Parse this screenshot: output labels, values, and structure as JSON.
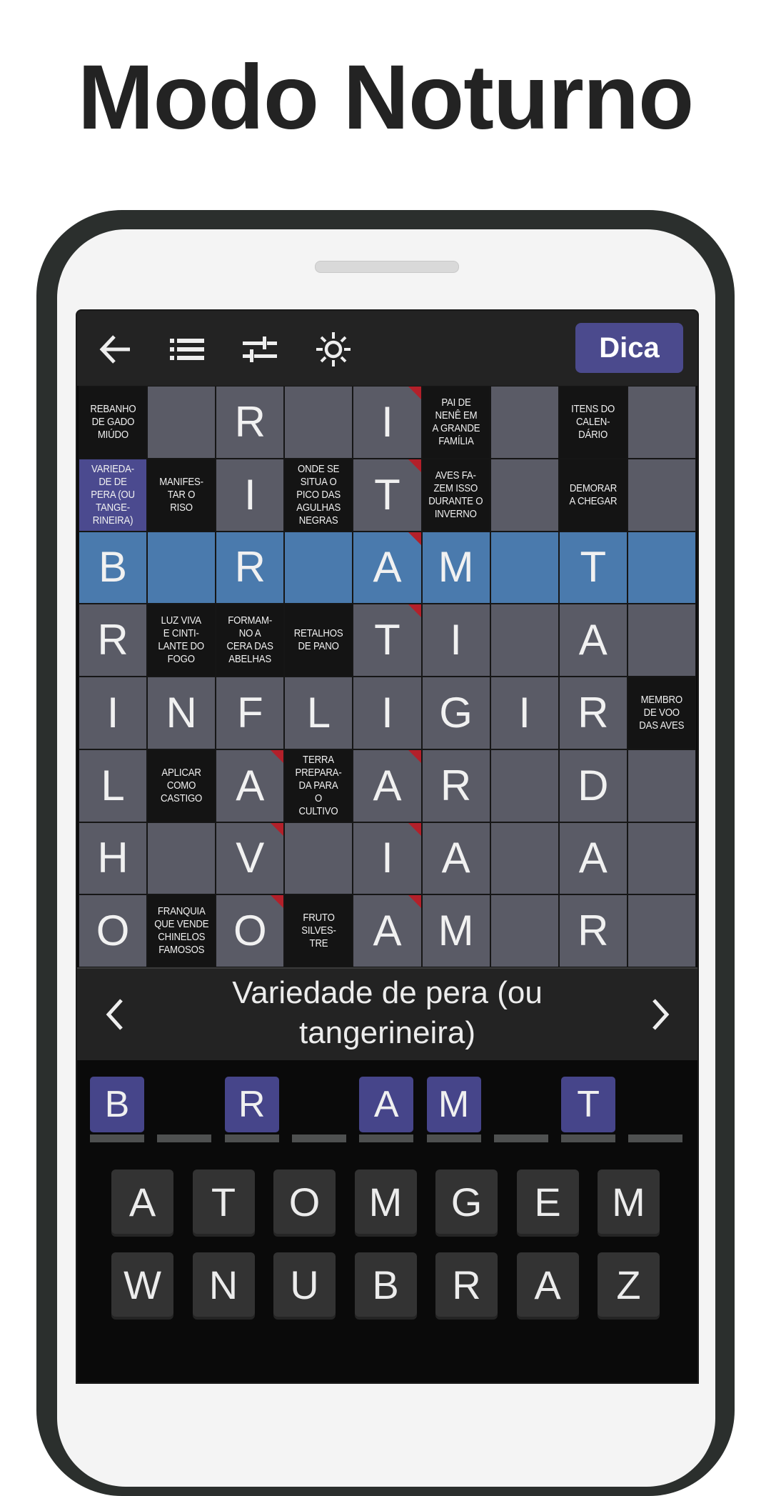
{
  "title": "Modo Noturno",
  "toolbar": {
    "icons": [
      "arrow-left-icon",
      "list-icon",
      "sliders-icon",
      "sun-icon"
    ],
    "hint_label": "Dica",
    "hint_color": "#4b4a8d"
  },
  "colors": {
    "cell": "#5a5b66",
    "clue_cell": "#141414",
    "highlight": "#4a7aad",
    "selected": "#4b4a8f",
    "mark": "#b3202a"
  },
  "grid": {
    "highlight_row": 2,
    "selected_cell": [
      1,
      0
    ],
    "rows": [
      [
        {
          "t": "clue",
          "v": "REBANHO\nDE GADO\nMIÚDO"
        },
        {
          "t": "empty",
          "v": ""
        },
        {
          "t": "letter",
          "v": "R"
        },
        {
          "t": "empty",
          "v": ""
        },
        {
          "t": "letter",
          "v": "I",
          "m": true
        },
        {
          "t": "clue",
          "v": "PAI DE\nNENÊ EM\nA GRANDE\nFAMÍLIA"
        },
        {
          "t": "empty",
          "v": ""
        },
        {
          "t": "clue",
          "v": "ITENS DO\nCALEN-\nDÁRIO"
        },
        {
          "t": "empty",
          "v": ""
        }
      ],
      [
        {
          "t": "clue",
          "v": "VARIEDA-\nDE DE\nPERA (OU\nTANGE-\nRINEIRA)"
        },
        {
          "t": "clue",
          "v": "MANIFES-\nTAR O\nRISO"
        },
        {
          "t": "letter",
          "v": "I"
        },
        {
          "t": "clue",
          "v": "ONDE SE\nSITUA O\nPICO DAS\nAGULHAS\nNEGRAS"
        },
        {
          "t": "letter",
          "v": "T",
          "m": true
        },
        {
          "t": "clue",
          "v": "AVES FA-\nZEM ISSO\nDURANTE O\nINVERNO"
        },
        {
          "t": "empty",
          "v": ""
        },
        {
          "t": "clue",
          "v": "DEMORAR\nA CHEGAR"
        },
        {
          "t": "empty",
          "v": ""
        }
      ],
      [
        {
          "t": "letter",
          "v": "B"
        },
        {
          "t": "empty",
          "v": ""
        },
        {
          "t": "letter",
          "v": "R"
        },
        {
          "t": "empty",
          "v": ""
        },
        {
          "t": "letter",
          "v": "A",
          "m": true
        },
        {
          "t": "letter",
          "v": "M"
        },
        {
          "t": "empty",
          "v": ""
        },
        {
          "t": "letter",
          "v": "T"
        },
        {
          "t": "empty",
          "v": ""
        }
      ],
      [
        {
          "t": "letter",
          "v": "R"
        },
        {
          "t": "clue",
          "v": "LUZ VIVA\nE CINTI-\nLANTE DO\nFOGO"
        },
        {
          "t": "clue",
          "v": "FORMAM-\nNO A\nCERA DAS\nABELHAS"
        },
        {
          "t": "clue",
          "v": "RETALHOS\nDE PANO"
        },
        {
          "t": "letter",
          "v": "T",
          "m": true
        },
        {
          "t": "letter",
          "v": "I"
        },
        {
          "t": "empty",
          "v": ""
        },
        {
          "t": "letter",
          "v": "A"
        },
        {
          "t": "empty",
          "v": ""
        }
      ],
      [
        {
          "t": "letter",
          "v": "I"
        },
        {
          "t": "letter",
          "v": "N"
        },
        {
          "t": "letter",
          "v": "F"
        },
        {
          "t": "letter",
          "v": "L"
        },
        {
          "t": "letter",
          "v": "I"
        },
        {
          "t": "letter",
          "v": "G"
        },
        {
          "t": "letter",
          "v": "I"
        },
        {
          "t": "letter",
          "v": "R"
        },
        {
          "t": "clue",
          "v": "MEMBRO\nDE VOO\nDAS AVES"
        }
      ],
      [
        {
          "t": "letter",
          "v": "L"
        },
        {
          "t": "clue",
          "v": "APLICAR\nCOMO\nCASTIGO"
        },
        {
          "t": "letter",
          "v": "A",
          "m": true
        },
        {
          "t": "clue",
          "v": "TERRA\nPREPARA-\nDA PARA\nO\nCULTIVO"
        },
        {
          "t": "letter",
          "v": "A",
          "m": true
        },
        {
          "t": "letter",
          "v": "R"
        },
        {
          "t": "empty",
          "v": ""
        },
        {
          "t": "letter",
          "v": "D"
        },
        {
          "t": "empty",
          "v": ""
        }
      ],
      [
        {
          "t": "letter",
          "v": "H"
        },
        {
          "t": "empty",
          "v": ""
        },
        {
          "t": "letter",
          "v": "V",
          "m": true
        },
        {
          "t": "empty",
          "v": ""
        },
        {
          "t": "letter",
          "v": "I",
          "m": true
        },
        {
          "t": "letter",
          "v": "A"
        },
        {
          "t": "empty",
          "v": ""
        },
        {
          "t": "letter",
          "v": "A"
        },
        {
          "t": "empty",
          "v": ""
        }
      ],
      [
        {
          "t": "letter",
          "v": "O"
        },
        {
          "t": "clue",
          "v": "FRANQUIA\nQUE VENDE\nCHINELOS\nFAMOSOS"
        },
        {
          "t": "letter",
          "v": "O",
          "m": true
        },
        {
          "t": "clue",
          "v": "FRUTO\nSILVES-\nTRE"
        },
        {
          "t": "letter",
          "v": "A",
          "m": true
        },
        {
          "t": "letter",
          "v": "M"
        },
        {
          "t": "empty",
          "v": ""
        },
        {
          "t": "letter",
          "v": "R"
        },
        {
          "t": "empty",
          "v": ""
        }
      ]
    ]
  },
  "clue_bar": {
    "text": "Variedade de pera (ou tangerineira)",
    "prev_icon": "chevron-left-icon",
    "next_icon": "chevron-right-icon"
  },
  "answer": [
    "B",
    "",
    "R",
    "",
    "A",
    "M",
    "",
    "T",
    ""
  ],
  "keyboard": {
    "row1": [
      "A",
      "T",
      "O",
      "M",
      "G",
      "E",
      "M"
    ],
    "row2": [
      "W",
      "N",
      "U",
      "B",
      "R",
      "A",
      "Z"
    ]
  }
}
